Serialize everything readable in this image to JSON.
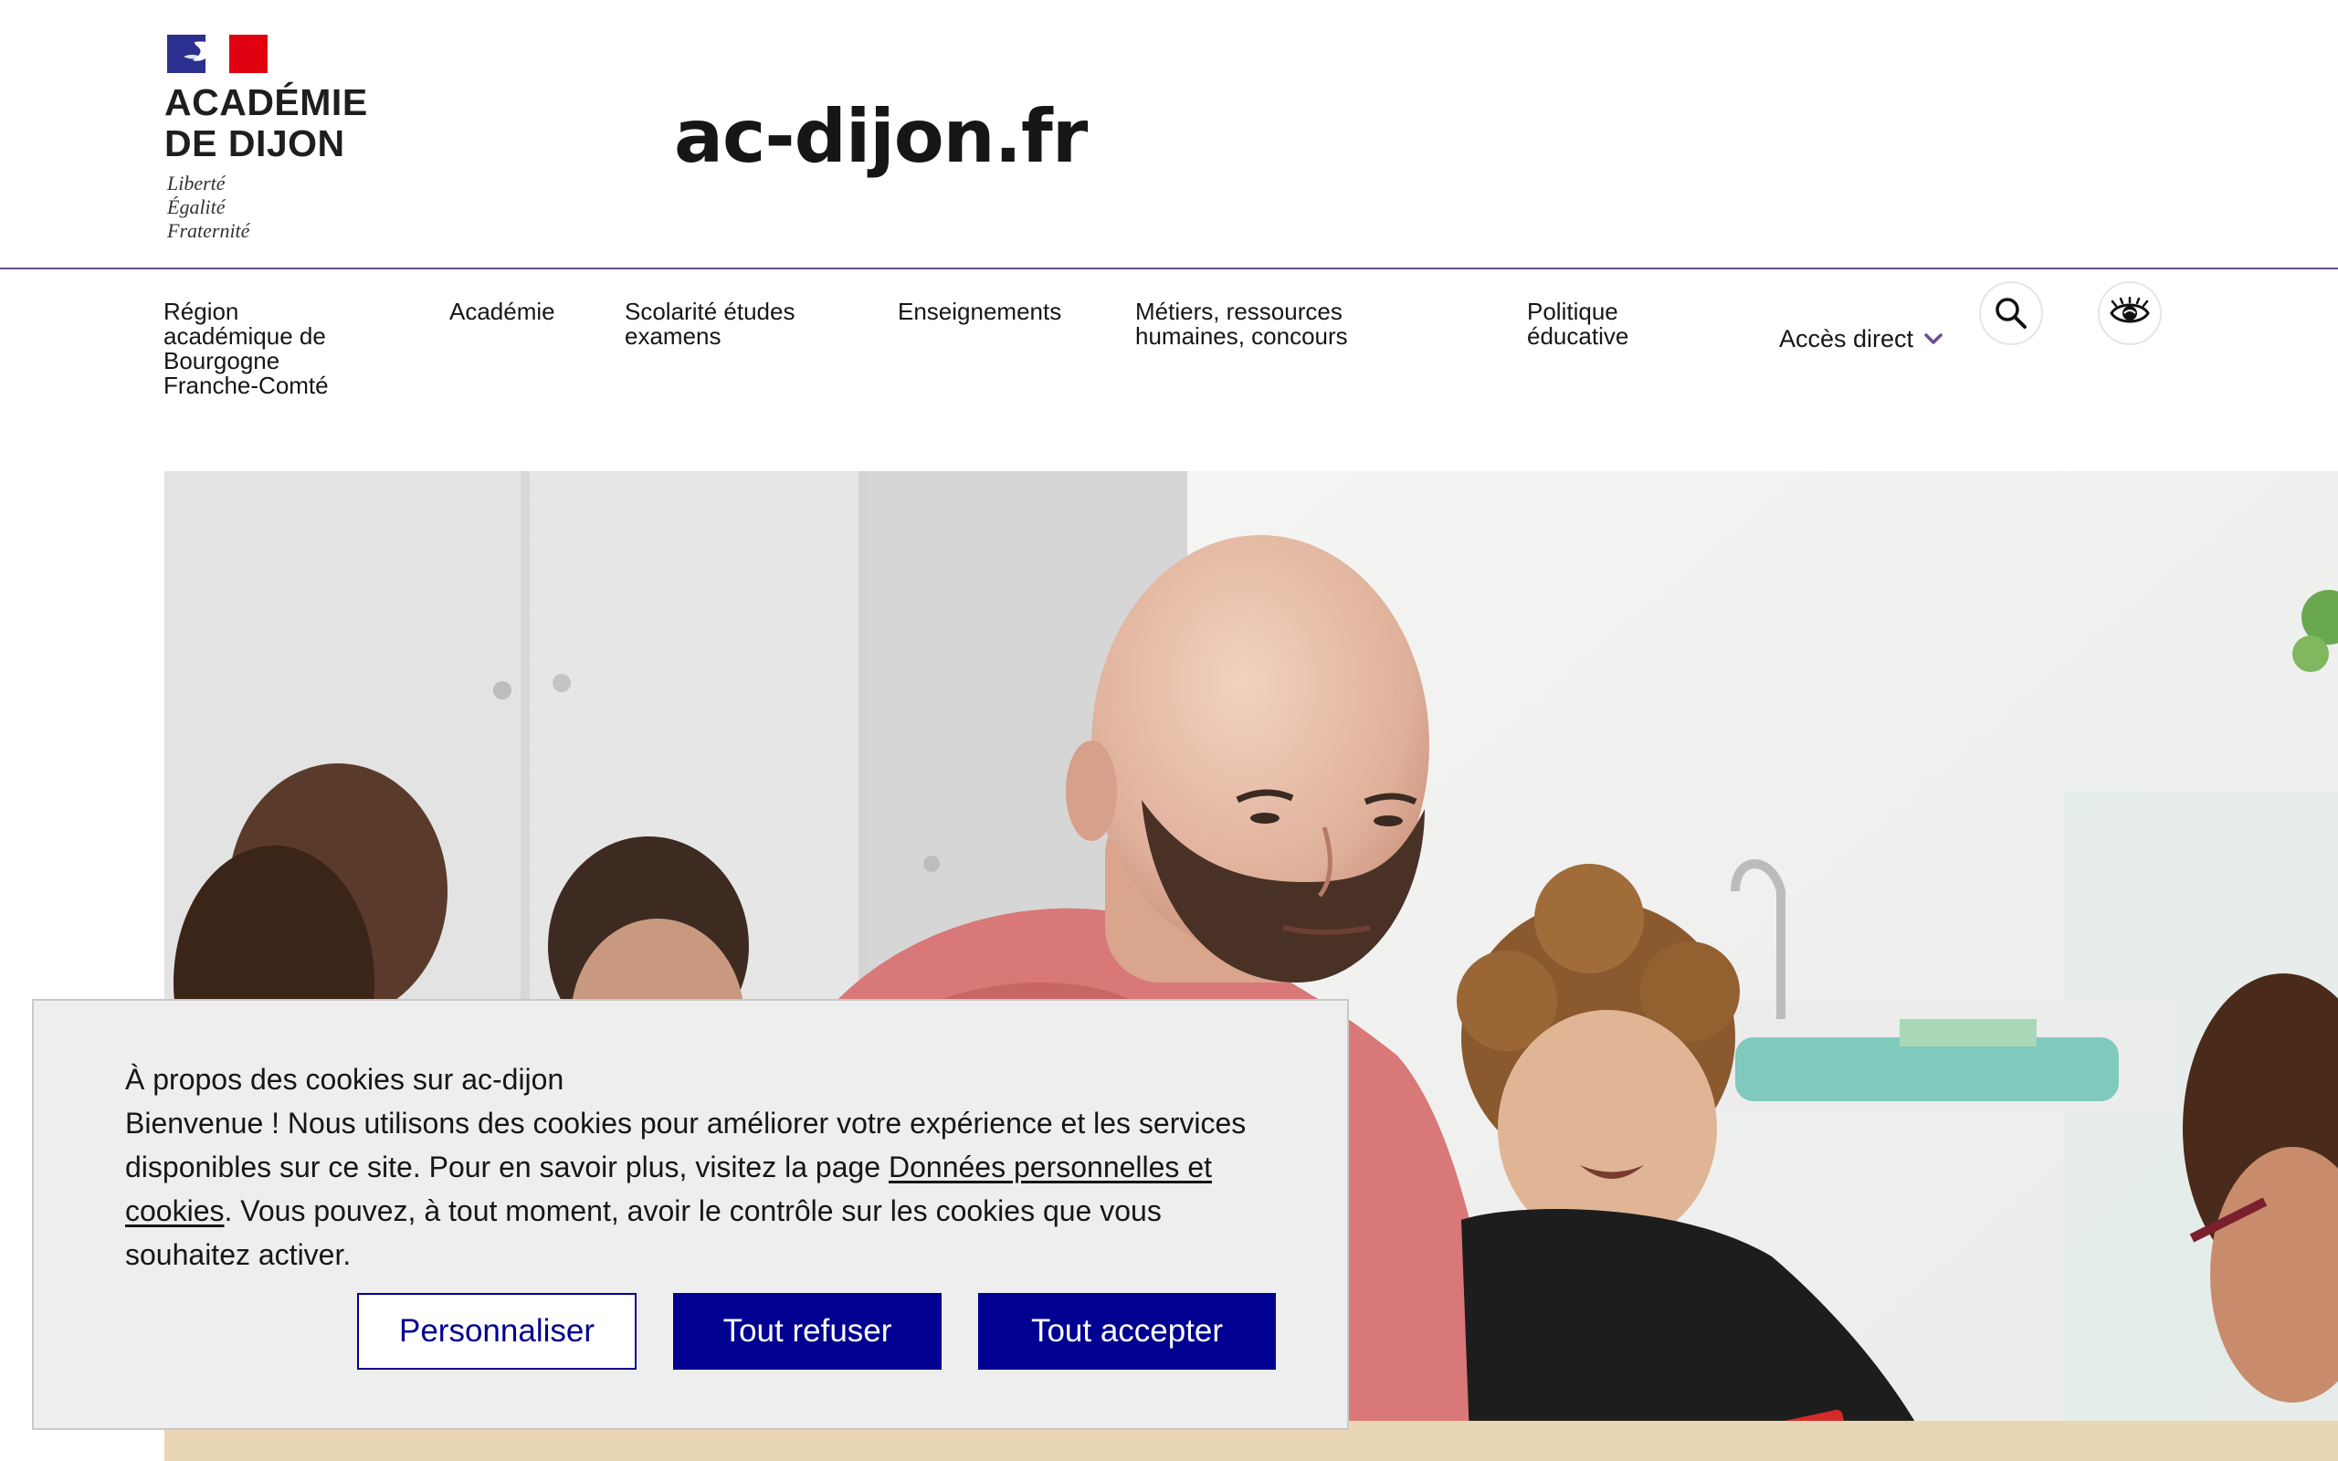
{
  "header": {
    "logo": {
      "line1": "ACADÉMIE",
      "line2": "DE DIJON",
      "motto": [
        "Liberté",
        "Égalité",
        "Fraternité"
      ]
    },
    "site_name": "ac-dijon.fr"
  },
  "nav": {
    "items": [
      {
        "lines": [
          "Région",
          "académique de",
          "Bourgogne",
          "Franche-Comté"
        ]
      },
      {
        "lines": [
          "Académie"
        ]
      },
      {
        "lines": [
          "Scolarité études",
          "examens"
        ]
      },
      {
        "lines": [
          "Enseignements"
        ]
      },
      {
        "lines": [
          "Métiers, ressources",
          "humaines, concours"
        ]
      },
      {
        "lines": [
          "Politique",
          "éducative"
        ]
      }
    ],
    "acces_direct": "Accès direct",
    "search_icon": "search-icon",
    "display_settings_icon": "eye-icon"
  },
  "cookie": {
    "title": "À propos des cookies sur ac-dijon",
    "text_before_link": "Bienvenue ! Nous utilisons des cookies pour améliorer votre expérience et les services disponibles sur ce site. Pour en savoir plus, visitez la page ",
    "link": "Données personnelles et cookies",
    "text_after_link": ". Vous pouvez, à tout moment, avoir le contrôle sur les cookies que vous souhaitez activer.",
    "buttons": {
      "personnaliser": "Personnaliser",
      "refuser": "Tout refuser",
      "accepter": "Tout accepter"
    }
  },
  "colors": {
    "primary": "#000091",
    "accent_purple": "#6a4c93",
    "banner_bg": "#eeeeee",
    "marianne_blue": "#000091",
    "marianne_red": "#e1000f"
  }
}
